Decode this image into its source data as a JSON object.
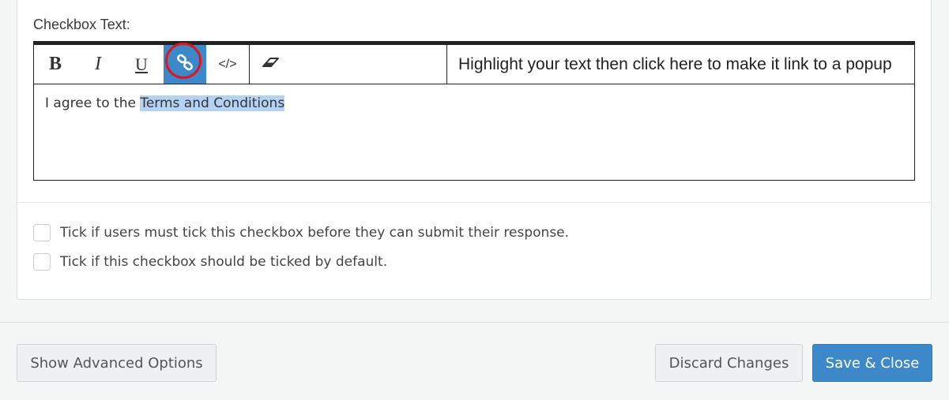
{
  "editor_section": {
    "label": "Checkbox Text:",
    "toolbar": {
      "bold": "B",
      "italic": "I",
      "underline": "U",
      "link_icon": "link-icon",
      "code": "</>",
      "eraser_icon": "eraser-icon",
      "hint": "Highlight your text then click here to make it link to a popup"
    },
    "content": {
      "plain_text": "I agree to the ",
      "selected_text": "Terms and Conditions"
    }
  },
  "options": [
    {
      "label": "Tick if users must tick this checkbox before they can submit their response.",
      "checked": false
    },
    {
      "label": "Tick if this checkbox should be ticked by default.",
      "checked": false
    }
  ],
  "footer": {
    "advanced_label": "Show Advanced Options",
    "discard_label": "Discard Changes",
    "save_label": "Save & Close"
  },
  "colors": {
    "accent": "#3c88c8",
    "highlight": "#b4d3f4",
    "annotation": "#e3141b"
  }
}
